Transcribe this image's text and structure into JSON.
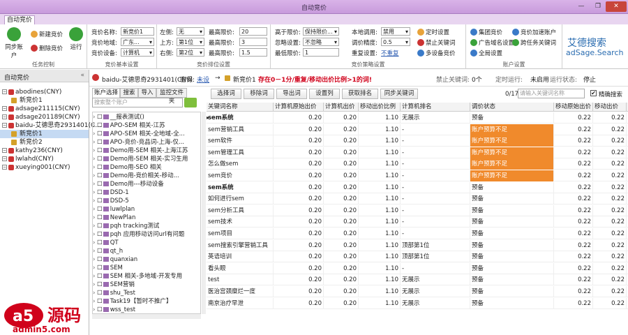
{
  "window": {
    "title": "自动竞价",
    "min": "—",
    "max": "❐",
    "close": "✕"
  },
  "ribbon_tab": "自动竞价",
  "ribbon": {
    "sync_label": "同步账户",
    "new_bid": "新建竞价",
    "del_bid": "删除竞价",
    "run": "运行",
    "group1": "任务控制",
    "name_label": "竞价名称:",
    "name_value": "新竞价1",
    "region_label": "竞价地域:",
    "region_value": "广东...",
    "device_label": "竞价设备:",
    "device_value": "计算机",
    "group2": "竞价基本设置",
    "left_label": "左侧:",
    "left_value": "无",
    "upper_label": "上方:",
    "upper_value": "第1位",
    "right_label": "右侧:",
    "right_value": "第2位",
    "maxbid_label": "最高限价:",
    "maxbid_l": "20",
    "maxbid_u": "3",
    "maxbid_r": "1.5",
    "group3": "竞价排位设置",
    "above_label": "高于限价:",
    "above_value": "保持限价...",
    "ignore_label": "忽略设置:",
    "ignore_value": "不忽略",
    "lowest_label": "最低限价:",
    "lowest_value": "1",
    "local_label": "本地调用:",
    "local_value": "禁用",
    "precision_label": "调价精度:",
    "precision_value": "0.5",
    "repeat_label": "重复设置:",
    "repeat_value": "不重复",
    "group4": "竞价策略设置",
    "timer": "定时设置",
    "forbid": "禁止关键词",
    "multi": "多设备竞价",
    "group_bid": "集团竞价",
    "ad_domain": "广告域名设置",
    "global": "全局设置",
    "accel": "竞价加速账户",
    "cross": "跨任务关键词",
    "group5": "账户设置",
    "brand": "艾德搜索",
    "brand_en": "adSage.Search"
  },
  "left_panel": {
    "title": "自动竞价",
    "chev": "«",
    "items": [
      {
        "label": "abodines(CNY)"
      },
      {
        "label": "新竞价1"
      },
      {
        "label": "adsage211115(CNY)"
      },
      {
        "label": "adsage201189(CNY)"
      },
      {
        "label": "baidu-艾德思奇2931401(C..."
      },
      {
        "label": "新竞价1"
      },
      {
        "label": "新竞价2"
      },
      {
        "label": "kathy236(CNY)"
      },
      {
        "label": "lwlahd(CNY)"
      },
      {
        "label": "xueying001(CNY)"
      }
    ]
  },
  "info": {
    "account": "baidu-艾德思奇2931401(CNY)",
    "pwd_label": "密保:",
    "pwd_value": "未设",
    "arrow": "→",
    "task": "新竞价1",
    "warning": "存在0－1分/重复/移动出价比例>1的词!",
    "forbid_label": "禁止关键词:",
    "forbid_value": "0个",
    "timer_label": "定时运行:",
    "timer_value": "未启用",
    "state_label": "运行状态:",
    "state_value": "停止"
  },
  "center_tabs": [
    "账户选择",
    "搜索",
    "导入",
    "监控文件夹"
  ],
  "center_search": "搜索整个账户",
  "tree": [
    "__报表测试()",
    "APO-SEM 相关-江苏",
    "APO-SEM 相关-全地域-全...",
    "APO-竞价-竞品词-上海-仅...",
    "Demo用-SEM 相关-上海江苏",
    "Demo用-SEM 相关-实习生用",
    "Demo用-SEO 相关",
    "Demo用-竞价相关-移动...",
    "Demo用---移动设备",
    "DSD-1",
    "DSD-5",
    "luwlplan",
    "NewPlan",
    "pqh tracking测试",
    "pqh 应用移动访问url有问题",
    "QT",
    "qt_h",
    "quanxian",
    "SEM",
    "SEM 相关-多地域-开发专用",
    "SEM营销",
    "shu_Test",
    "Task19【暂时不推广】",
    "wss_test"
  ],
  "toolbar": [
    "选择词",
    "移除词",
    "导出词",
    "设置列",
    "获取排名",
    "同步关键词"
  ],
  "count": "0/17",
  "kw_search": "请输入关键词名称",
  "exact_label": "精确搜索",
  "exact_check": "✔",
  "table": {
    "headers": [
      "关键词名称",
      "计算机原始出价",
      "计算机出价",
      "移动出价比例",
      "计算机排名",
      "调价状态",
      "移动原始出价",
      "移动出价",
      "移"
    ],
    "rows": [
      [
        "sem系统",
        "0.20",
        "0.20",
        "1.10",
        "无展示",
        "预备",
        "0.22",
        "0.22"
      ],
      [
        "sem营销工具",
        "0.20",
        "0.20",
        "1.10",
        "-",
        "账户预算不足",
        "0.22",
        "0.22"
      ],
      [
        "sem软件",
        "0.20",
        "0.20",
        "1.10",
        "-",
        "账户预算不足",
        "0.22",
        "0.22"
      ],
      [
        "sem管理工具",
        "0.20",
        "0.20",
        "1.10",
        "-",
        "账户预算不足",
        "0.22",
        "0.22"
      ],
      [
        "怎么做sem",
        "0.20",
        "0.20",
        "1.10",
        "-",
        "账户预算不足",
        "0.22",
        "0.22"
      ],
      [
        "sem竞价",
        "0.20",
        "0.20",
        "1.10",
        "-",
        "账户预算不足",
        "0.22",
        "0.22"
      ],
      [
        "sem系统",
        "0.20",
        "0.20",
        "1.10",
        "-",
        "预备",
        "0.22",
        "0.22"
      ],
      [
        "如何进行sem",
        "0.20",
        "0.20",
        "1.10",
        "-",
        "预备",
        "0.22",
        "0.22"
      ],
      [
        "sem分析工具",
        "0.20",
        "0.20",
        "1.10",
        "-",
        "预备",
        "0.22",
        "0.22"
      ],
      [
        "sem技术",
        "0.20",
        "0.20",
        "1.10",
        "-",
        "预备",
        "0.22",
        "0.22"
      ],
      [
        "sem项目",
        "0.20",
        "0.20",
        "1.10",
        "-",
        "预备",
        "0.22",
        "0.22"
      ],
      [
        "sem搜索引擎营销工具",
        "0.20",
        "0.20",
        "1.10",
        "顶部第1位",
        "预备",
        "0.22",
        "0.22"
      ],
      [
        "英语培训",
        "0.20",
        "0.20",
        "1.10",
        "顶部第1位",
        "预备",
        "0.22",
        "0.22"
      ],
      [
        "看头眼",
        "0.20",
        "0.20",
        "1.10",
        "-",
        "预备",
        "0.22",
        "0.22"
      ],
      [
        "test",
        "0.20",
        "0.20",
        "1.10",
        "无展示",
        "预备",
        "0.22",
        "0.22"
      ],
      [
        "医治宫颈糜烂一度",
        "0.20",
        "0.20",
        "1.10",
        "无展示",
        "预备",
        "0.22",
        "0.22"
      ],
      [
        "南京治疗早泄",
        "0.20",
        "0.20",
        "1.10",
        "无展示",
        "预备",
        "0.22",
        "0.22"
      ]
    ]
  },
  "watermark": {
    "a5": "a5",
    "site_cn": "源码",
    "site": "admin5.com"
  },
  "colors": {
    "accent": "#c89bdc",
    "orange": "#f08a2c",
    "warn": "#d0021b"
  }
}
